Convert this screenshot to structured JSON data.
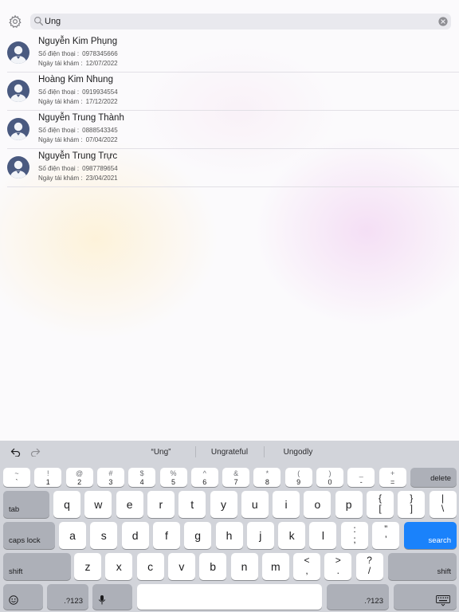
{
  "search": {
    "value": "Ung",
    "settings_icon": "gear-icon",
    "search_icon": "magnifier-icon",
    "clear_icon": "clear-circle-icon"
  },
  "results": [
    {
      "name": "Nguyễn Kim Phụng",
      "phone_label": "Số điện thoại :",
      "phone": "0978345666",
      "date_label": "Ngày tái khám :",
      "date": "12/07/2022"
    },
    {
      "name": "Hoàng Kim Nhung",
      "phone_label": "Số điện thoại :",
      "phone": "0919934554",
      "date_label": "Ngày tái khám :",
      "date": "17/12/2022"
    },
    {
      "name": "Nguyễn Trung Thành",
      "phone_label": "Số điện thoại :",
      "phone": "0888543345",
      "date_label": "Ngày tái khám :",
      "date": "07/04/2022"
    },
    {
      "name": "Nguyễn Trung Trực",
      "phone_label": "Số điện thoại :",
      "phone": "0987789654",
      "date_label": "Ngày tái khám :",
      "date": "23/04/2021"
    }
  ],
  "keyboard": {
    "suggestions": [
      "“Ung”",
      "Ungrateful",
      "Ungodly"
    ],
    "number_row": [
      {
        "top": "~",
        "bottom": "`"
      },
      {
        "top": "!",
        "bottom": "1"
      },
      {
        "top": "@",
        "bottom": "2"
      },
      {
        "top": "#",
        "bottom": "3"
      },
      {
        "top": "$",
        "bottom": "4"
      },
      {
        "top": "%",
        "bottom": "5"
      },
      {
        "top": "^",
        "bottom": "6"
      },
      {
        "top": "&",
        "bottom": "7"
      },
      {
        "top": "*",
        "bottom": "8"
      },
      {
        "top": "(",
        "bottom": "9"
      },
      {
        "top": ")",
        "bottom": "0"
      },
      {
        "top": "_",
        "bottom": "-"
      },
      {
        "top": "+",
        "bottom": "="
      }
    ],
    "delete": "delete",
    "tab": "tab",
    "row_q": [
      "q",
      "w",
      "e",
      "r",
      "t",
      "y",
      "u",
      "i",
      "o",
      "p"
    ],
    "brackets": [
      {
        "top": "{",
        "bottom": "["
      },
      {
        "top": "}",
        "bottom": "]"
      },
      {
        "top": "|",
        "bottom": "\\"
      }
    ],
    "caps_lock": "caps lock",
    "row_a": [
      "a",
      "s",
      "d",
      "f",
      "g",
      "h",
      "j",
      "k",
      "l"
    ],
    "punct_a": [
      {
        "top": ":",
        "bottom": ";"
      },
      {
        "top": "”",
        "bottom": "’"
      }
    ],
    "search": "search",
    "shift": "shift",
    "row_z": [
      "z",
      "x",
      "c",
      "v",
      "b",
      "n",
      "m"
    ],
    "punct_z": [
      {
        "top": "<",
        "bottom": ","
      },
      {
        "top": ">",
        "bottom": "."
      },
      {
        "top": "?",
        "bottom": "/"
      }
    ],
    "numbers": ".?123",
    "accent_color": "#1a82fb"
  }
}
